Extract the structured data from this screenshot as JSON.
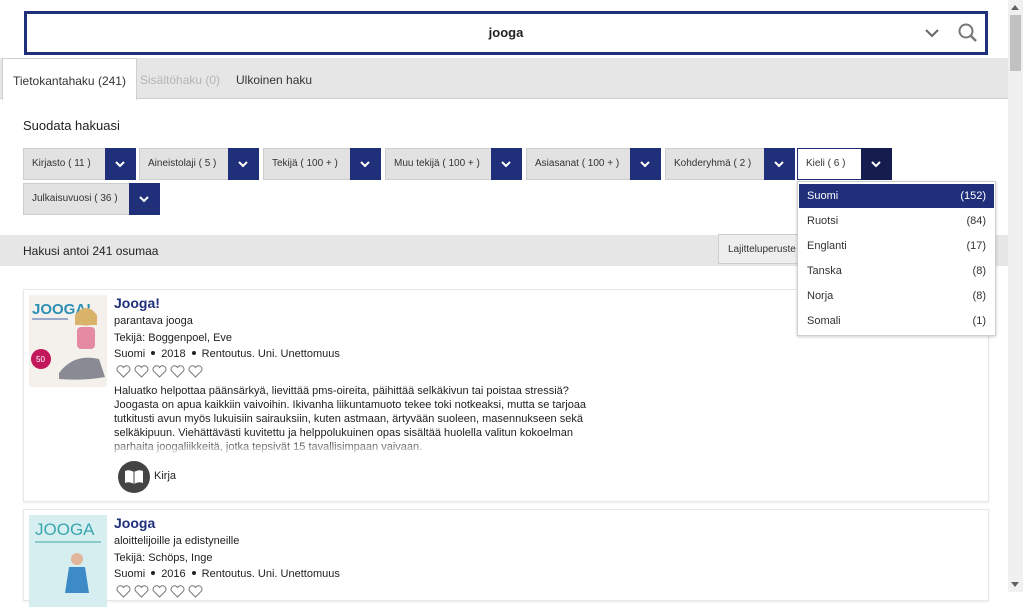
{
  "search": {
    "query": "jooga"
  },
  "tabs": [
    {
      "label": "Tietokantahaku (241)",
      "state": "active"
    },
    {
      "label": "Sisältöhaku (0)",
      "state": "disabled"
    },
    {
      "label": "Ulkoinen haku",
      "state": "normal"
    }
  ],
  "filters": {
    "title": "Suodata hakuasi",
    "facets": [
      {
        "label": "Kirjasto ( 11 )"
      },
      {
        "label": "Aineistolaji ( 5 )"
      },
      {
        "label": "Tekijä ( 100 + )"
      },
      {
        "label": "Muu tekijä ( 100 + )"
      },
      {
        "label": "Asiasanat ( 100 + )"
      },
      {
        "label": "Kohderyhmä ( 2 )"
      },
      {
        "label": "Kieli ( 6 )"
      },
      {
        "label": "Julkaisuvuosi ( 36 )"
      }
    ]
  },
  "language_dropdown": {
    "options": [
      {
        "name": "Suomi",
        "count": "(152)",
        "selected": true
      },
      {
        "name": "Ruotsi",
        "count": "(84)"
      },
      {
        "name": "Englanti",
        "count": "(17)"
      },
      {
        "name": "Tanska",
        "count": "(8)"
      },
      {
        "name": "Norja",
        "count": "(8)"
      },
      {
        "name": "Somali",
        "count": "(1)"
      }
    ]
  },
  "results": {
    "summary": "Hakusi antoi 241 osumaa",
    "sort_label": "Lajitteluperuste R",
    "items": [
      {
        "title": "Jooga!",
        "subtitle": "parantava jooga",
        "author": "Tekijä: Boggenpoel, Eve",
        "language": "Suomi",
        "year": "2018",
        "subjects": "Rentoutus. Uni. Unettomuus",
        "cover_text": "JOOGA!",
        "description": "Haluatko helpottaa päänsärkyä, lievittää pms-oireita, päihittää selkäkivun tai poistaa stressiä? Joogasta on apua kaikkiin vaivoihin. Ikivanha liikuntamuoto tekee toki notkeaksi, mutta se tarjoaa tutkitusti avun myös lukuisiin sairauksiin, kuten astmaan, ärtyvään suoleen, masennukseen sekä selkäkipuun. Viehättävästi kuvitettu ja helppolukuinen opas sisältää huolella valitun kokoelman parhaita joogaliikkeitä, jotka tepsivät 15 tavallisimpaan vaivaan.",
        "material_type": "Kirja",
        "icon": "book-icon"
      },
      {
        "title": "Jooga",
        "subtitle": "aloittelijoille ja edistyneille",
        "author": "Tekijä: Schöps, Inge",
        "language": "Suomi",
        "year": "2016",
        "subjects": "Rentoutus. Uni. Unettomuus",
        "cover_text": "JOOGA"
      }
    ]
  },
  "colors": {
    "brand": "#1f2f7a",
    "brand_dark": "#141d4e",
    "tab_bg": "#e6e6e6"
  }
}
